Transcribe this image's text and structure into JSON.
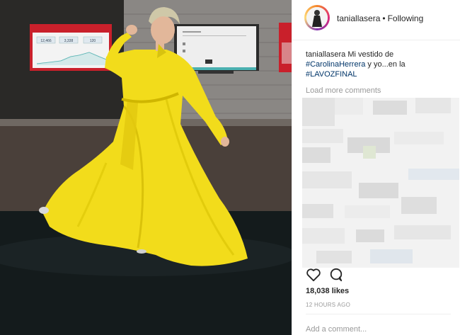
{
  "post": {
    "username": "taniallasera",
    "follow_state": "Following",
    "separator": "•",
    "caption_user": "taniallasera",
    "caption_text_1": " Mi vestido de ",
    "caption_tag_1": "#CarolinaHerrera",
    "caption_text_2": " y yo...en la ",
    "caption_tag_2": "#LAVOZFINAL",
    "load_more": "Load more comments",
    "likes": "18,038 likes",
    "time_ago": "12 HOURS AGO",
    "add_comment_placeholder": "Add a comment..."
  },
  "photo_screens": {
    "left_values": [
      "12,466",
      "3,338",
      "120"
    ]
  },
  "icons": {
    "like": "heart-outline-icon",
    "comment": "speech-bubble-icon"
  },
  "colors": {
    "dress": "#f2dc1b",
    "hashtag": "#003569",
    "muted": "#999999",
    "text": "#262626"
  }
}
